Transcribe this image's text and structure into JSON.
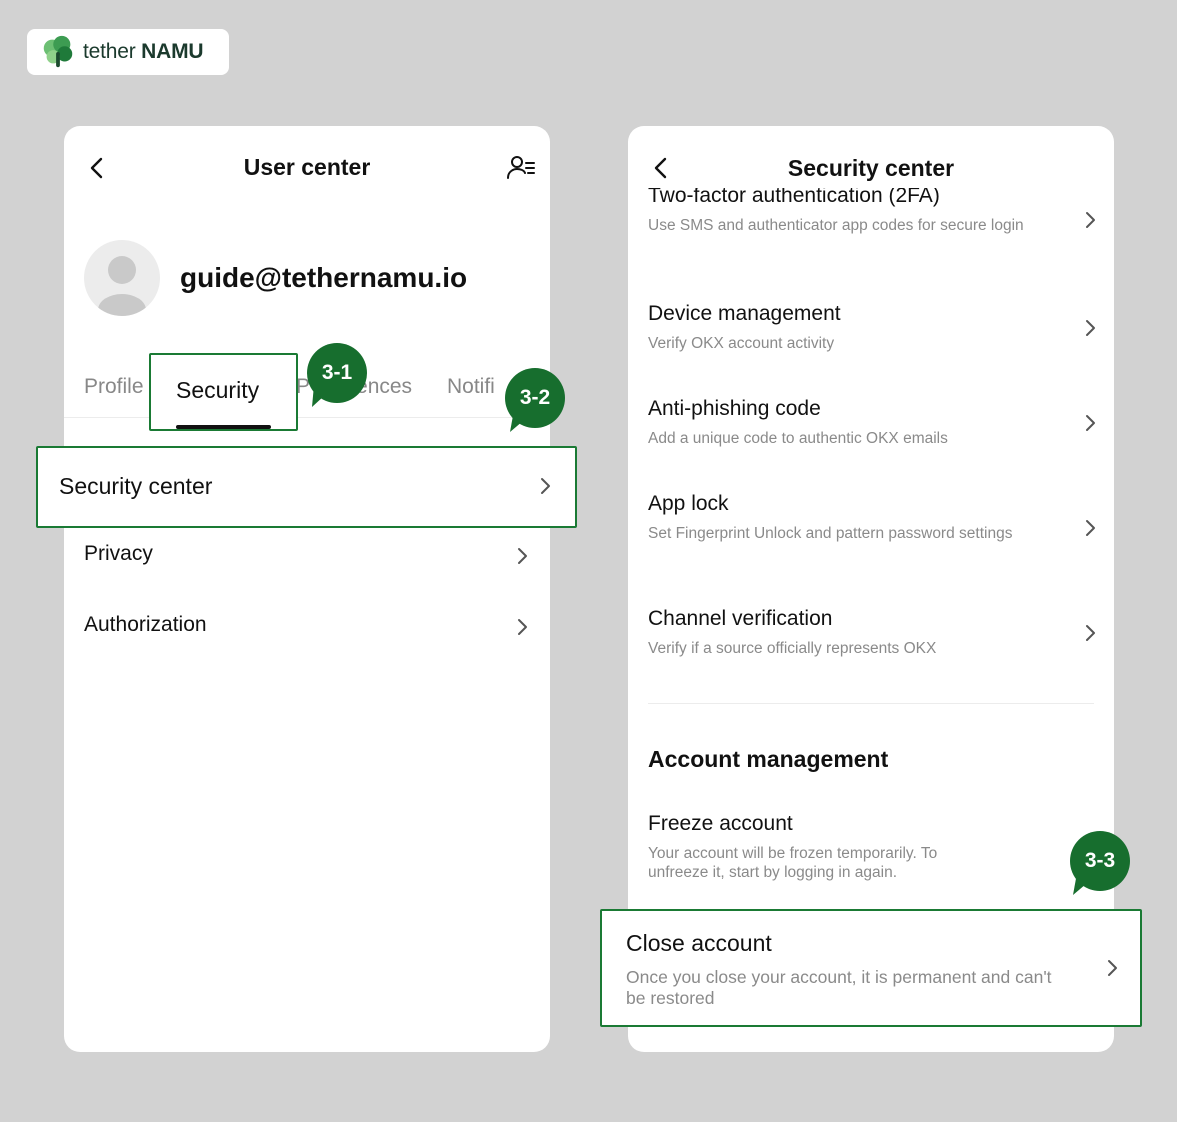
{
  "logo": {
    "text_light": "tether",
    "text_bold": "NAMU"
  },
  "left": {
    "title": "User center",
    "email": "guide@tethernamu.io",
    "tabs": [
      "Profile",
      "Security",
      "Preferences",
      "Notifications"
    ],
    "tabs_visible": {
      "profile": "Profile",
      "security": "Security",
      "prefs_part": "P",
      "prefs_tail": "ences",
      "notif_part": "Notifi"
    },
    "rows": [
      "Security center",
      "Privacy",
      "Authorization"
    ]
  },
  "right": {
    "title": "Security center",
    "items": [
      {
        "title": "Two-factor authentication (2FA)",
        "desc": "Use SMS and authenticator app codes for secure login"
      },
      {
        "title": "Device management",
        "desc": "Verify OKX account activity"
      },
      {
        "title": "Anti-phishing code",
        "desc": "Add a unique code to authentic OKX emails"
      },
      {
        "title": "App lock",
        "desc": "Set Fingerprint Unlock and pattern password settings"
      },
      {
        "title": "Channel verification",
        "desc": "Verify if a source officially represents OKX"
      }
    ],
    "section": "Account management",
    "freeze": {
      "title": "Freeze account",
      "desc": "Your account will be frozen temporarily. To unfreeze it, start by logging in again."
    },
    "close": {
      "title": "Close account",
      "desc": "Once you close your account, it is permanent and can't be restored"
    }
  },
  "badges": [
    "3-1",
    "3-2",
    "3-3"
  ],
  "colors": {
    "accent": "#176e2e",
    "highlight_border": "#1a7a34",
    "background": "#d2d2d2"
  },
  "icons": [
    "tree-logo-icon",
    "back-icon",
    "user-settings-icon",
    "avatar-icon",
    "chevron-right-icon"
  ]
}
